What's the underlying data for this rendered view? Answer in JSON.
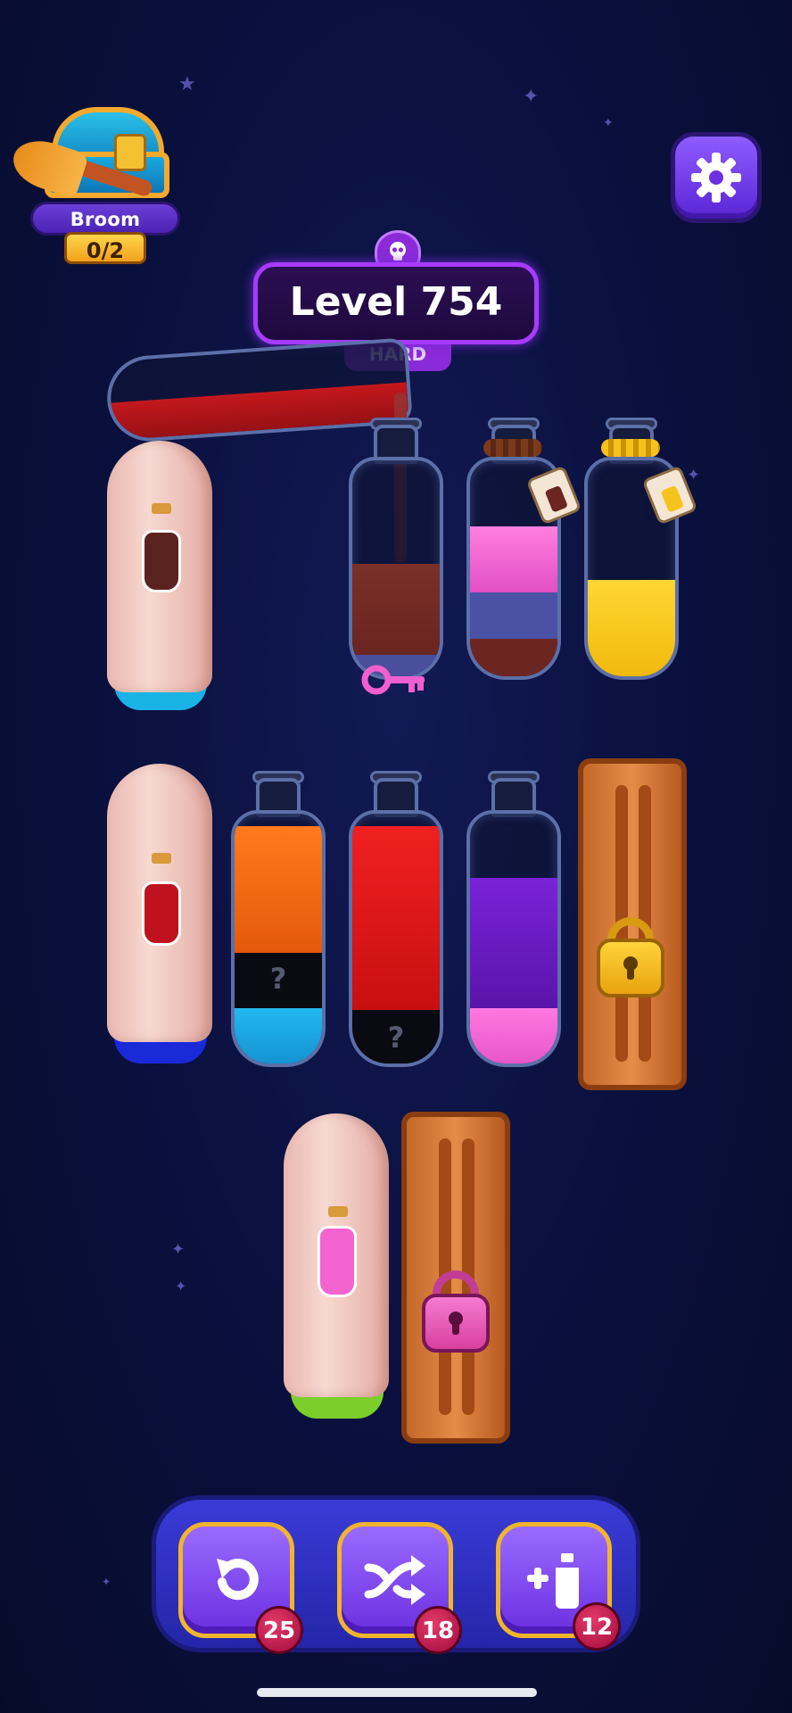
{
  "streak": {
    "title": "Broom Streak",
    "progress": "0/2"
  },
  "level": {
    "label": "Level 754",
    "difficulty": "HARD"
  },
  "tubes": {
    "row1": [
      {
        "state": "covered-ghost",
        "hint_color": "#5a2320",
        "base_color": "#1ab3e5"
      },
      {
        "state": "open",
        "layers": [
          "#7a2f27",
          "#4a4f9c"
        ],
        "has_key": true
      },
      {
        "state": "tied",
        "layers": [
          "#f05fcf",
          "#4b52a5",
          "#6b2622"
        ]
      },
      {
        "state": "tied",
        "layers": [
          "#f6c21c"
        ]
      }
    ],
    "row2": [
      {
        "state": "covered-ghost",
        "hint_color": "#c0121e",
        "base_color": "#1a2ad8"
      },
      {
        "state": "open",
        "layers": [
          "#ef6b16",
          "hidden",
          "#1aa7e0"
        ],
        "hidden_mark": "?"
      },
      {
        "state": "open",
        "layers": [
          "#de1818",
          "hidden"
        ],
        "hidden_mark": "?"
      },
      {
        "state": "open",
        "layers": [
          "#6a1bc7",
          "#f564d5"
        ]
      },
      {
        "state": "locked-crate",
        "lock_color": "#f3b51d"
      }
    ],
    "row3": [
      {
        "state": "covered-ghost",
        "hint_color": "#f364d1",
        "base_color": "#7ccf2b"
      },
      {
        "state": "locked-crate",
        "lock_color": "#e95fb7"
      }
    ]
  },
  "pour": {
    "liquid_color": "#c4181c"
  },
  "toolbar": {
    "undo": {
      "icon": "undo-icon",
      "count": "25"
    },
    "shuffle": {
      "icon": "shuffle-icon",
      "count": "18"
    },
    "add_tube": {
      "icon": "add-bottle-icon",
      "count": "12"
    }
  },
  "colors": {
    "accent": "#7b3df0",
    "frame": "#f0b52a",
    "badge": "#c4174a"
  }
}
